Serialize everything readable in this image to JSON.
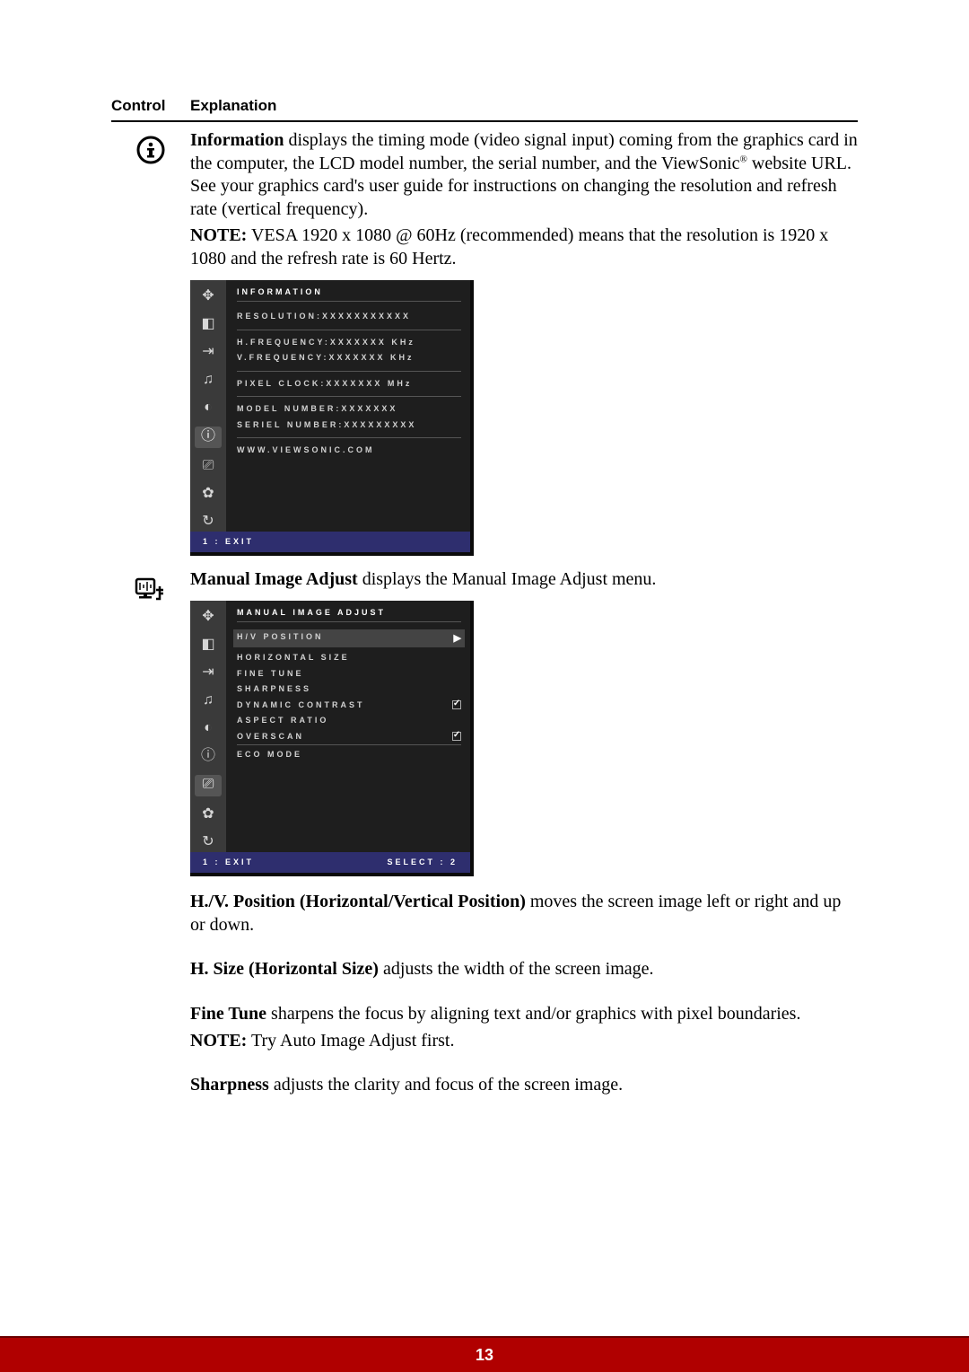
{
  "header": {
    "control": "Control",
    "explanation": "Explanation"
  },
  "info": {
    "lead": "Information",
    "text": " displays the timing mode (video signal input) coming from the graphics card in the computer, the LCD model number, the serial number, and the ViewSonic",
    "sup": "®",
    "text2": " website URL. See your graphics card's user guide for instructions on changing the resolution and refresh rate (vertical frequency).",
    "note_label": "NOTE:",
    "note_text": " VESA 1920 x 1080 @ 60Hz (recommended) means that the resolution is 1920 x 1080 and the refresh rate is 60 Hertz."
  },
  "osd1": {
    "title": "INFORMATION",
    "lines": {
      "res": "RESOLUTION:XXXXXXXXXXX",
      "hfreq": "H.FREQUENCY:XXXXXXX KHz",
      "vfreq": "V.FREQUENCY:XXXXXXX KHz",
      "pclock": "PIXEL CLOCK:XXXXXXX  MHz",
      "model": "MODEL NUMBER:XXXXXXX",
      "serial": "SERIEL NUMBER:XXXXXXXXX",
      "url": "WWW.VIEWSONIC.COM"
    },
    "footer_left": "1 : EXIT"
  },
  "manual": {
    "lead": "Manual Image Adjust",
    "text": " displays the Manual Image Adjust menu."
  },
  "osd2": {
    "title": "MANUAL IMAGE ADJUST",
    "items": {
      "hv": "H/V POSITION",
      "hsize": "HORIZONTAL SIZE",
      "ftune": "FINE TUNE",
      "sharp": "SHARPNESS",
      "dyn": "DYNAMIC CONTRAST",
      "aspect": "ASPECT RATIO",
      "over": "OVERSCAN",
      "eco": "ECO MODE"
    },
    "footer_left": "1 : EXIT",
    "footer_right": "SELECT : 2"
  },
  "hvpos": {
    "lead": "H./V. Position (Horizontal/Vertical Position)",
    "text": " moves the screen image left or right and up or down."
  },
  "hsize": {
    "lead": "H. Size (Horizontal Size)",
    "text": " adjusts the width of the screen image."
  },
  "ftune": {
    "lead": "Fine Tune",
    "text": " sharpens the focus by aligning text and/or graphics with pixel boundaries.",
    "note_label": "NOTE:",
    "note_text": " Try Auto Image Adjust first."
  },
  "sharp": {
    "lead": "Sharpness",
    "text": " adjusts the clarity and focus of the screen image."
  },
  "page_number": "13"
}
